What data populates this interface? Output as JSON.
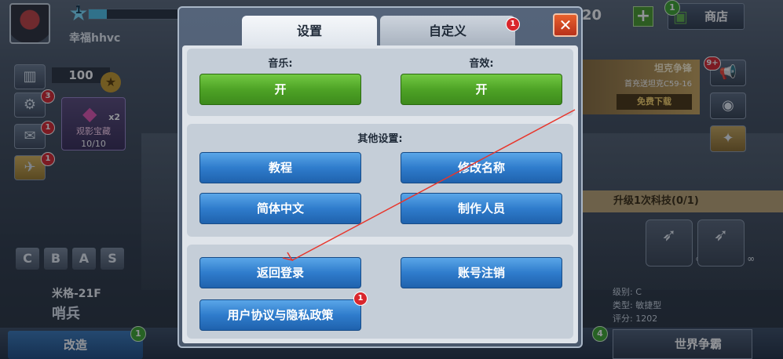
{
  "player": {
    "level": "1",
    "name": "幸福hhvc"
  },
  "hud": {
    "rank_value": "100",
    "settings_badge": "3",
    "mail_badge": "1",
    "hangar_badge": "1",
    "gem_card": {
      "multiplier": "x2",
      "label": "观影宝藏",
      "count": "10/10"
    },
    "letters": [
      "C",
      "B",
      "A",
      "S"
    ],
    "aircraft_name": "米格-21F",
    "aircraft_class": "哨兵",
    "modify_label": "改造",
    "modify_badge": "1",
    "currency": "20",
    "shop_label": "商店",
    "shop_badge": "1",
    "promo": {
      "title": "坦克争锋",
      "subtitle": "首充送坦克C59-16",
      "download": "免费下载"
    },
    "notice_badge": "9+",
    "task": "升级1次科技(0/1)",
    "weapon_inf": [
      "∞",
      "∞"
    ],
    "stats": {
      "level": "级别: C",
      "type": "类型: 敏捷型",
      "score": "评分: 1202"
    },
    "world_label": "世界争霸",
    "world_badge": "4"
  },
  "dialog": {
    "tabs": [
      {
        "label": "设置",
        "active": true
      },
      {
        "label": "自定义",
        "active": false,
        "badge": "1"
      }
    ],
    "close_glyph": "✕",
    "audio": {
      "music_label": "音乐:",
      "music_value": "开",
      "sfx_label": "音效:",
      "sfx_value": "开"
    },
    "other": {
      "label": "其他设置:",
      "buttons": [
        "教程",
        "修改名称",
        "简体中文",
        "制作人员"
      ]
    },
    "account": {
      "return_login": "返回登录",
      "delete_account": "账号注销",
      "privacy": "用户协议与隐私政策",
      "privacy_badge": "1"
    }
  },
  "colors": {
    "toggle_on": "#4ea326",
    "button_blue": "#2f7ccc",
    "badge_red": "#d9262c",
    "annotation": "#e8352b"
  }
}
